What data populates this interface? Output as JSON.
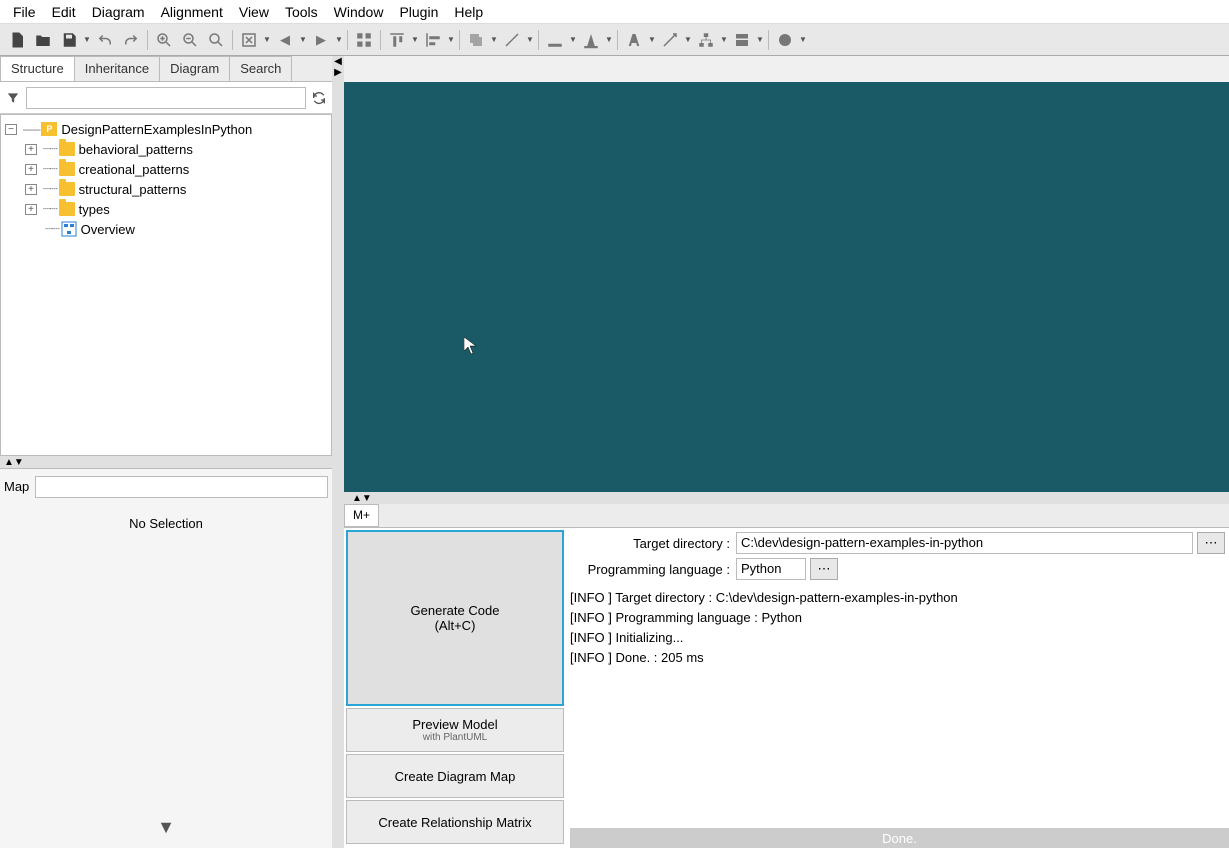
{
  "menu": [
    "File",
    "Edit",
    "Diagram",
    "Alignment",
    "View",
    "Tools",
    "Window",
    "Plugin",
    "Help"
  ],
  "left_tabs": [
    "Structure",
    "Inheritance",
    "Diagram",
    "Search"
  ],
  "tree": {
    "root": "DesignPatternExamplesInPython",
    "children": [
      "behavioral_patterns",
      "creational_patterns",
      "structural_patterns",
      "types"
    ],
    "leaf": "Overview"
  },
  "map_label": "Map",
  "no_selection": "No Selection",
  "bottom_tab": "M+",
  "buttons": {
    "generate": "Generate Code",
    "generate_k": "(Alt+C)",
    "preview": "Preview Model",
    "preview_sub": "with PlantUML",
    "diagmap": "Create Diagram Map",
    "relmatrix": "Create Relationship Matrix"
  },
  "info": {
    "target_label": "Target directory :",
    "target_val": "C:\\dev\\design-pattern-examples-in-python",
    "lang_label": "Programming language :",
    "lang_val": "Python"
  },
  "log": [
    "[INFO ] Target directory : C:\\dev\\design-pattern-examples-in-python",
    "[INFO ] Programming language : Python",
    "[INFO ] Initializing...",
    "[INFO ] Done. : 205 ms"
  ],
  "status": "Done."
}
